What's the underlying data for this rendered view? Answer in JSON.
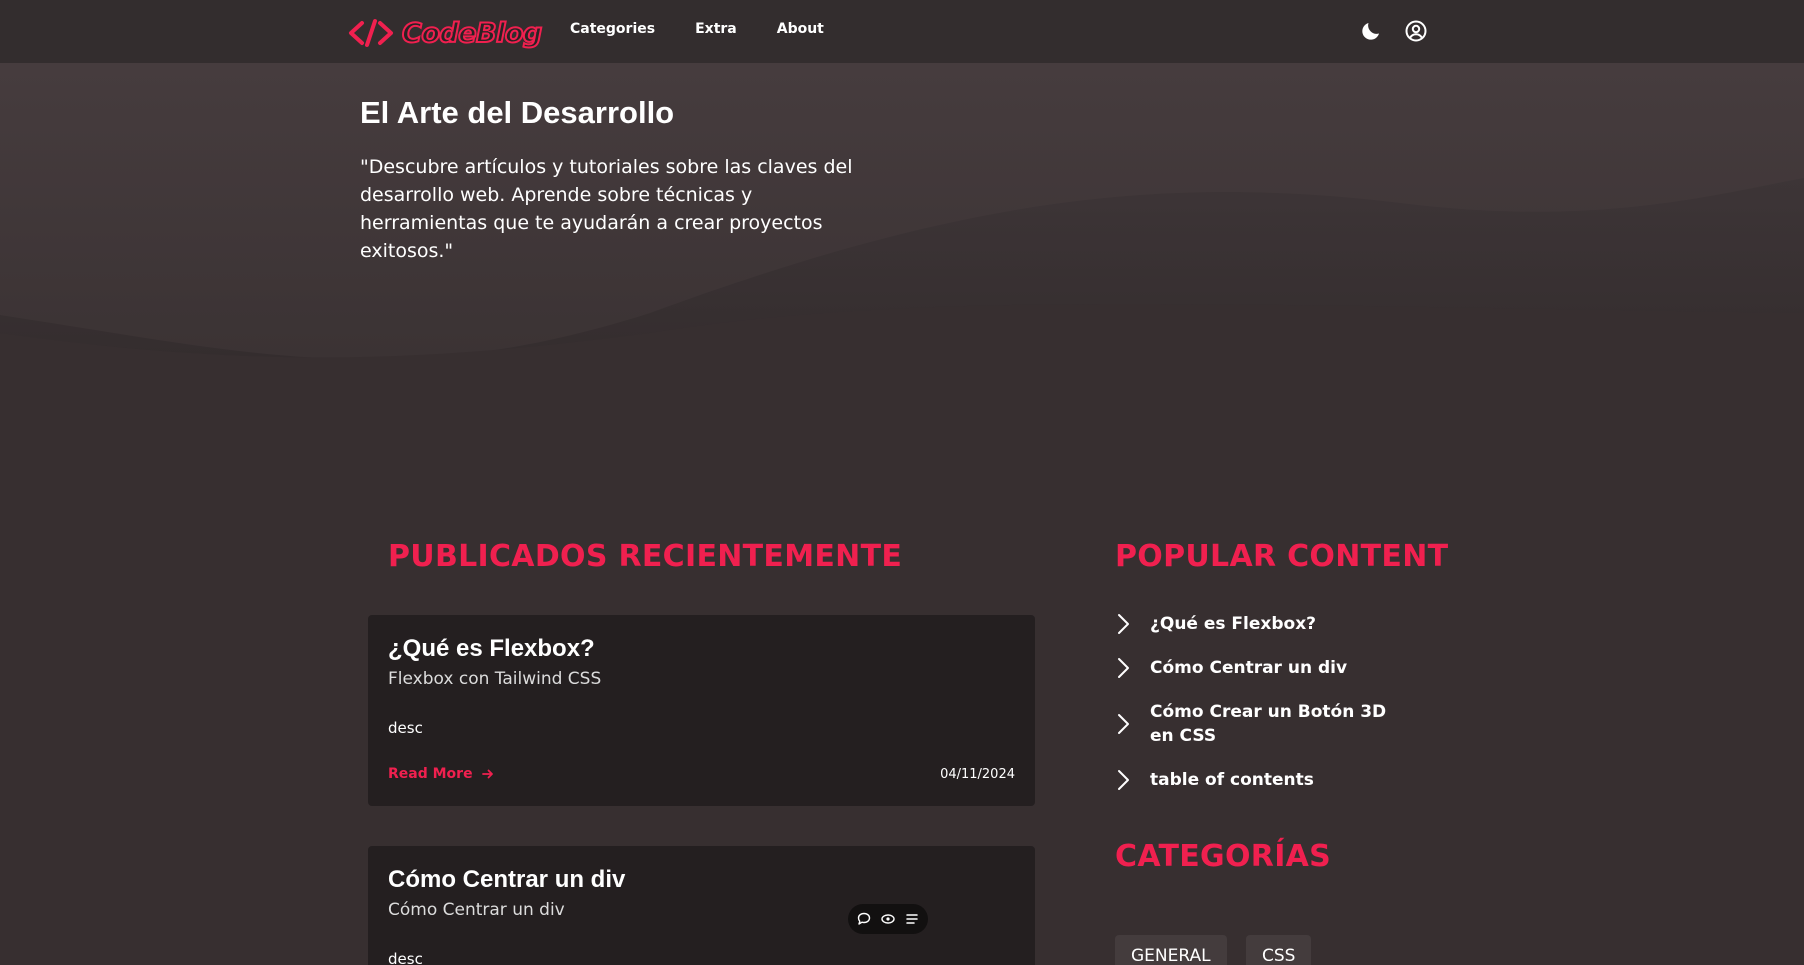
{
  "header": {
    "logo_text": "CodeBlog",
    "nav": [
      "Categories",
      "Extra",
      "About"
    ],
    "icons": [
      "theme-moon-icon",
      "user-account-icon"
    ]
  },
  "hero": {
    "title": "El Arte del Desarrollo",
    "description": "\"Descubre artículos y tutoriales sobre las claves del desarrollo web. Aprende sobre técnicas y herramientas que te ayudarán a crear proyectos exitosos.\""
  },
  "recent": {
    "heading": "PUBLICADOS RECIENTEMENTE",
    "posts": [
      {
        "title": "¿Qué es Flexbox?",
        "subtitle": "Flexbox con Tailwind CSS",
        "desc": "desc",
        "read_more": "Read More",
        "date": "04/11/2024"
      },
      {
        "title": "Cómo Centrar un div",
        "subtitle": "Cómo Centrar un div",
        "desc": "desc"
      }
    ]
  },
  "popular": {
    "heading": "POPULAR CONTENT",
    "items": [
      "¿Qué es Flexbox?",
      "Cómo Centrar un div",
      "Cómo Crear un Botón 3D en CSS",
      "table of contents"
    ]
  },
  "categories": {
    "heading": "CATEGORÍAS",
    "tags": [
      "GENERAL",
      "CSS"
    ]
  },
  "floating_toolbar": {
    "icons": [
      "comment-icon",
      "view-icon",
      "menu-list-icon"
    ]
  },
  "colors": {
    "accent": "#f0204f",
    "background": "#372f30",
    "header": "#332d2e",
    "card": "#241f20"
  }
}
